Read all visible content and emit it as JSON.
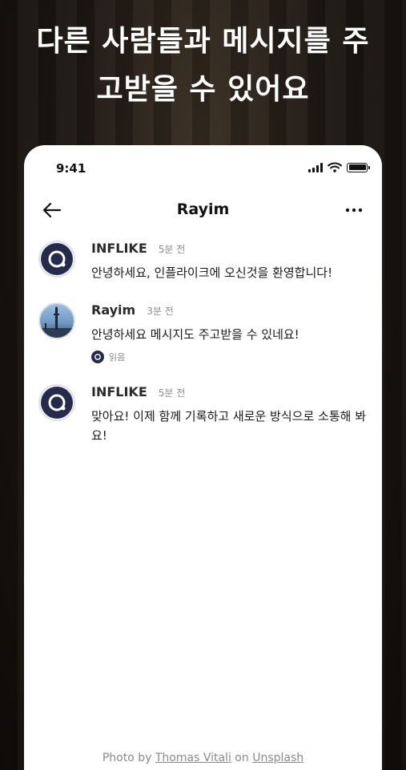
{
  "headline": {
    "line1": "다른 사람들과 메시지를 주",
    "line2": "고받을 수 있어요"
  },
  "status_bar": {
    "time": "9:41",
    "icons": [
      "cellular-signal-icon",
      "wifi-icon",
      "battery-icon"
    ]
  },
  "nav": {
    "title": "Rayim",
    "back_icon": "arrow-left-icon",
    "more_icon": "more-horizontal-icon"
  },
  "messages": [
    {
      "sender": "INFLIKE",
      "time": "5분 전",
      "text": "안녕하세요, 인플라이크에 오신것을 환영합니다!",
      "avatar": "brand-logo"
    },
    {
      "sender": "Rayim",
      "time": "3분 전",
      "text": "안녕하세요 메시지도 주고받을 수 있네요!",
      "avatar": "user-photo",
      "read_label": "읽음"
    },
    {
      "sender": "INFLIKE",
      "time": "5분 전",
      "text": "맞아요! 이제 함께 기록하고 새로운 방식으로 소통해 봐요!",
      "avatar": "brand-logo"
    }
  ],
  "credit": {
    "prefix": "Photo by",
    "author": "Thomas Vitali",
    "middle": "on",
    "source": "Unsplash"
  },
  "colors": {
    "brand_navy": "#262a4c",
    "background_dark": "#1f1913",
    "meta_gray": "#8c8c8c"
  }
}
